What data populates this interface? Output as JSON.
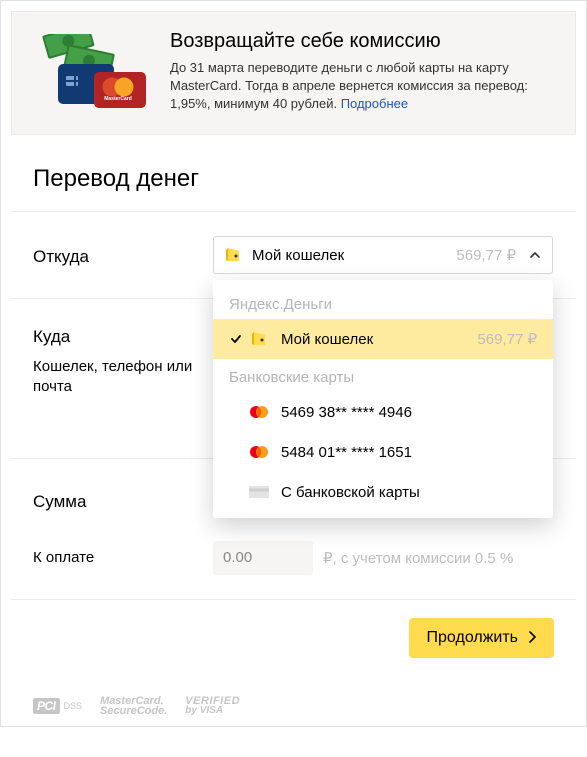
{
  "promo": {
    "title": "Возвращайте себе комиссию",
    "description_pre": "До 31 марта переводите деньги с любой карты на карту MasterCard. Тогда в апреле вернется комиссия за перевод: 1,95%, минимум 40 рублей. ",
    "link_label": "Подробнее"
  },
  "page_title": "Перевод денег",
  "from": {
    "label": "Откуда",
    "selected_label": "Мой кошелек",
    "selected_balance": "569,77 ₽"
  },
  "dropdown": {
    "group_wallet_title": "Яндекс.Деньги",
    "group_cards_title": "Банковские карты",
    "items": [
      {
        "id": "wallet",
        "label": "Мой кошелек",
        "balance": "569,77 ₽",
        "selected": true,
        "icon": "wallet"
      },
      {
        "id": "card1",
        "label": "5469 38** **** 4946",
        "icon": "mastercard"
      },
      {
        "id": "card2",
        "label": "5484 01** **** 1651",
        "icon": "mastercard"
      },
      {
        "id": "newcard",
        "label": "С банковской карты",
        "icon": "card"
      }
    ]
  },
  "to": {
    "label": "Куда",
    "sublabel": "Кошелек, телефон или почта"
  },
  "amount": {
    "label": "Сумма",
    "currency": "₽"
  },
  "topay": {
    "label": "К оплате",
    "value": "0.00",
    "note": "₽, с учетом комиссии 0.5 %"
  },
  "continue_label": "Продолжить",
  "badges": {
    "pci": "PCI",
    "dss": "DSS",
    "mc1": "MasterCard.",
    "mc2": "SecureCode.",
    "vv1": "VERIFIED",
    "vv2": "by VISA"
  }
}
